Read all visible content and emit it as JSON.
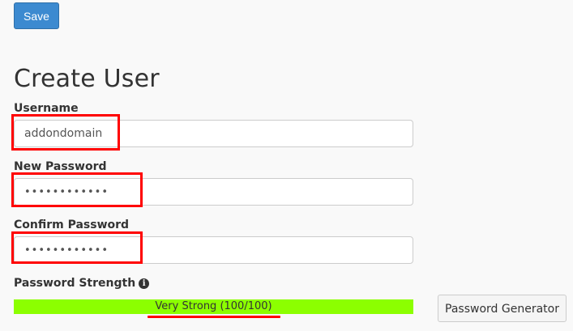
{
  "toolbar": {
    "save_label": "Save"
  },
  "page": {
    "title": "Create User"
  },
  "form": {
    "username": {
      "label": "Username",
      "value": "addondomain"
    },
    "new_password": {
      "label": "New Password",
      "value": "••••••••••••"
    },
    "confirm_password": {
      "label": "Confirm Password",
      "value": "••••••••••••"
    },
    "strength": {
      "label": "Password Strength",
      "info_icon": "info-icon",
      "text": "Very Strong (100/100)",
      "percent": 100,
      "bar_color": "#8cff00"
    },
    "generator": {
      "label": "Password Generator"
    }
  },
  "colors": {
    "primary_button": "#3c8ad0",
    "highlight": "#ff0000"
  }
}
